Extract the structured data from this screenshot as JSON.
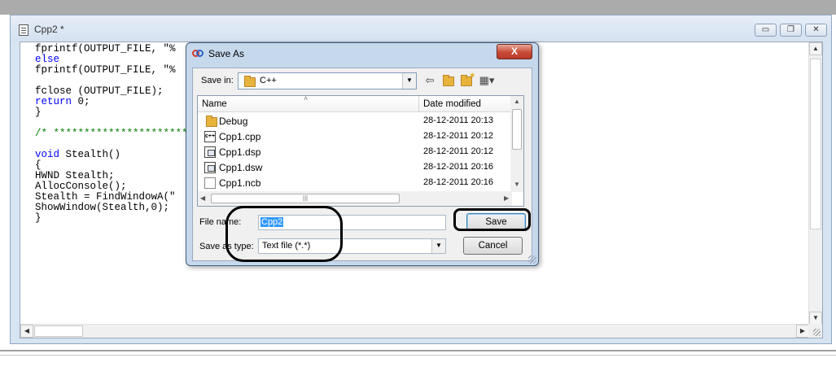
{
  "editor": {
    "title": "Cpp2 *",
    "controls": {
      "minimize": "▭",
      "restore": "❐",
      "close": "✕"
    },
    "code_lines": [
      {
        "text": "fprintf(OUTPUT_FILE, \"%",
        "kind": "normal"
      },
      {
        "text": "else",
        "kind": "keyword"
      },
      {
        "text": "fprintf(OUTPUT_FILE, \"%",
        "kind": "normal"
      },
      {
        "text": "",
        "kind": "normal"
      },
      {
        "text": "fclose (OUTPUT_FILE);",
        "kind": "normal"
      },
      {
        "text": "return 0;",
        "kind": "keyword"
      },
      {
        "text": "}",
        "kind": "normal"
      },
      {
        "text": "",
        "kind": "normal"
      },
      {
        "text": "/* ****************************",
        "kind": "comment"
      },
      {
        "text": "",
        "kind": "normal"
      },
      {
        "text": "void Stealth()",
        "kind": "keyword"
      },
      {
        "text": "{",
        "kind": "normal"
      },
      {
        "text": "HWND Stealth;",
        "kind": "normal"
      },
      {
        "text": "AllocConsole();",
        "kind": "normal"
      },
      {
        "text": "Stealth = FindWindowA(\"",
        "kind": "normal"
      },
      {
        "text": "ShowWindow(Stealth,0);",
        "kind": "normal"
      },
      {
        "text": "}",
        "kind": "normal"
      }
    ]
  },
  "dialog": {
    "title": "Save As",
    "close_label": "X",
    "save_in": {
      "label": "Save in:",
      "value": "C++"
    },
    "toolbar_icons": [
      "back-arrow-icon",
      "up-folder-icon",
      "new-folder-icon",
      "view-menu-icon"
    ],
    "columns": {
      "name": "Name",
      "date": "Date modified"
    },
    "files": [
      {
        "name": "Debug",
        "date": "28-12-2011 20:13",
        "icon": "folder"
      },
      {
        "name": "Cpp1.cpp",
        "date": "28-12-2011 20:12",
        "icon": "cpp"
      },
      {
        "name": "Cpp1.dsp",
        "date": "28-12-2011 20:12",
        "icon": "project"
      },
      {
        "name": "Cpp1.dsw",
        "date": "28-12-2011 20:16",
        "icon": "project"
      },
      {
        "name": "Cpp1.ncb",
        "date": "28-12-2011 20:16",
        "icon": "blank"
      }
    ],
    "file_name": {
      "label": "File name:",
      "value": "Cpp2"
    },
    "save_as_type": {
      "label": "Save as type:",
      "value": "Text file (*.*)"
    },
    "save_button": "Save",
    "cancel_button": "Cancel"
  }
}
